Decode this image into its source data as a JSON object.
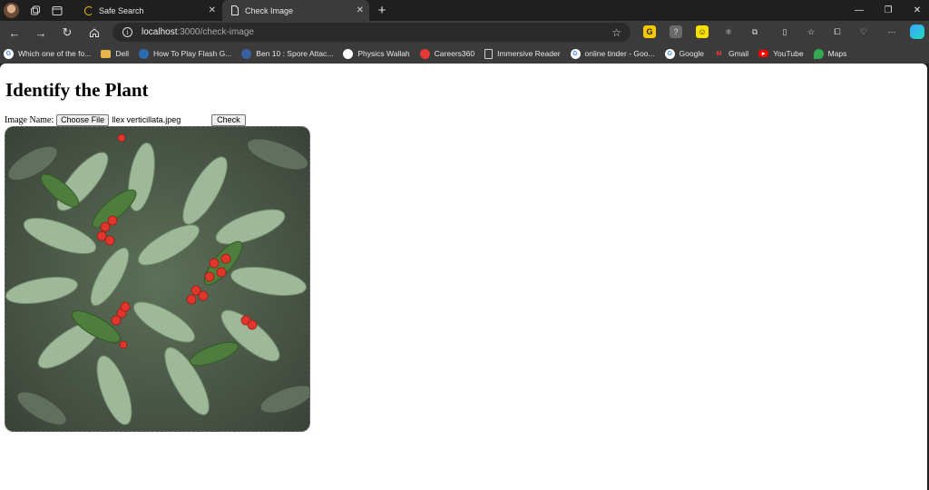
{
  "browser": {
    "tabs": [
      {
        "title": "Safe Search",
        "active": false
      },
      {
        "title": "Check Image",
        "active": true
      }
    ],
    "address": {
      "host": "localhost",
      "path": ":3000/check-image"
    },
    "bookmarks": [
      {
        "label": "Which one of the fo...",
        "icon": "google-icon",
        "color": "#4285f4"
      },
      {
        "label": "Dell",
        "icon": "folder-icon",
        "color": "#e8b54a"
      },
      {
        "label": "How To Play Flash G...",
        "icon": "site-icon",
        "color": "#2b6cb0"
      },
      {
        "label": "Ben 10 : Spore Attac...",
        "icon": "site-icon",
        "color": "#3a5f9e"
      },
      {
        "label": "Physics Wallah",
        "icon": "pw-icon",
        "color": "#ffffff"
      },
      {
        "label": "Careers360",
        "icon": "careers360-icon",
        "color": "#e53935"
      },
      {
        "label": "Immersive Reader",
        "icon": "page-icon",
        "color": "#cfcfcf"
      },
      {
        "label": "online tinder - Goo...",
        "icon": "google-icon",
        "color": "#4285f4"
      },
      {
        "label": "Google",
        "icon": "google-icon",
        "color": "#4285f4"
      },
      {
        "label": "Gmail",
        "icon": "gmail-icon",
        "color": "#ea4335"
      },
      {
        "label": "YouTube",
        "icon": "youtube-icon",
        "color": "#ff0000"
      },
      {
        "label": "Maps",
        "icon": "maps-icon",
        "color": "#34a853"
      }
    ]
  },
  "page": {
    "heading": "Identify the Plant",
    "image_label": "Image Name:",
    "choose_file": "Choose File",
    "file_name": "Ilex verticillata.jpeg",
    "check_button": "Check"
  }
}
